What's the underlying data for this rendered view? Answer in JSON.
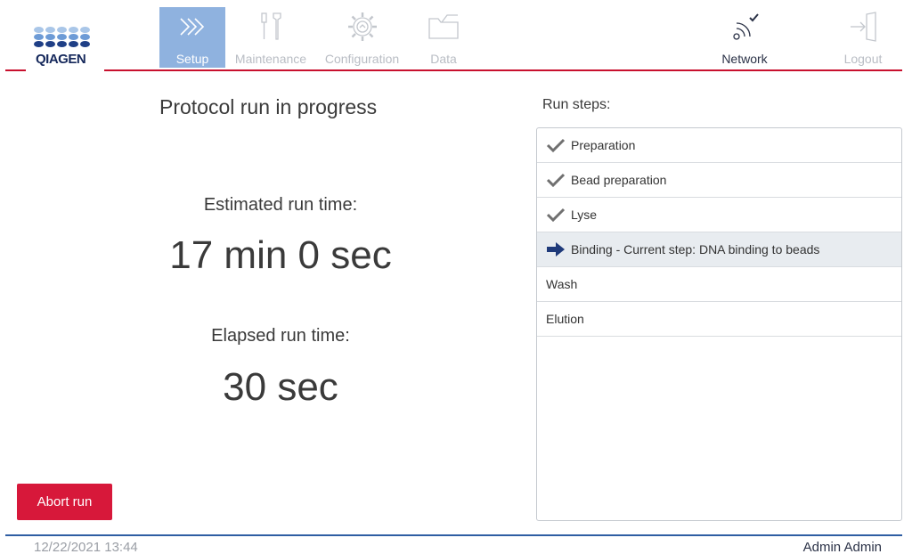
{
  "brand": {
    "logo_text": "QIAGEN"
  },
  "nav": {
    "setup": {
      "label": "Setup",
      "icon": "chevrons-right-icon"
    },
    "maintenance": {
      "label": "Maintenance",
      "icon": "tools-icon"
    },
    "configuration": {
      "label": "Configuration",
      "icon": "gear-icon"
    },
    "data": {
      "label": "Data",
      "icon": "folder-icon"
    },
    "network": {
      "label": "Network",
      "icon": "wifi-connected-icon"
    },
    "logout": {
      "label": "Logout",
      "icon": "logout-icon"
    }
  },
  "run": {
    "title": "Protocol run in progress",
    "estimated_label": "Estimated run time:",
    "estimated_value": "17 min 0 sec",
    "elapsed_label": "Elapsed run time:",
    "elapsed_value": "30 sec",
    "abort_label": "Abort run"
  },
  "steps": {
    "heading": "Run steps:",
    "items": [
      {
        "label": "Preparation",
        "status": "done"
      },
      {
        "label": "Bead preparation",
        "status": "done"
      },
      {
        "label": "Lyse",
        "status": "done"
      },
      {
        "label": "Binding - Current step: DNA binding to beads",
        "status": "current"
      },
      {
        "label": "Wash",
        "status": "pending"
      },
      {
        "label": "Elution",
        "status": "pending"
      }
    ]
  },
  "footer": {
    "datetime": "12/22/2021 13:44",
    "user": "Admin Admin"
  },
  "colors": {
    "brand_red": "#c8102e",
    "abort_red": "#d7183a",
    "active_tab": "#8fb2df",
    "footer_blue": "#2f5ea3",
    "logo_navy": "#15285b"
  }
}
